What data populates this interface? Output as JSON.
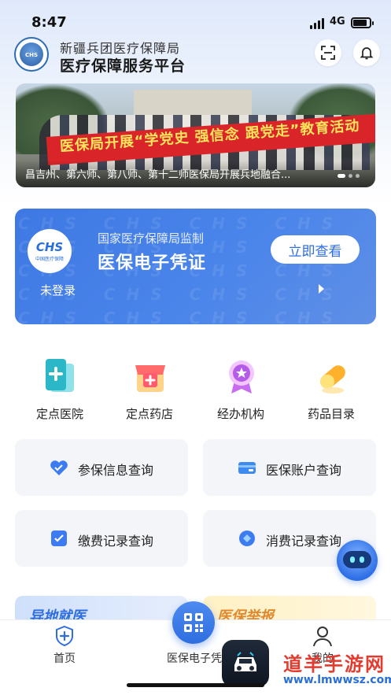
{
  "status_bar": {
    "time": "8:47",
    "network": "4G"
  },
  "header": {
    "org_name": "新疆兵团医疗保障局",
    "platform_name": "医疗保障服务平台",
    "logo_text": "CHS"
  },
  "banner": {
    "flag_text": "医保局开展“学党史 强信念 跟党走”教育活动",
    "caption": "昌吉州、第六师、第八师、第十二师医保局开展兵地融合..."
  },
  "credential_card": {
    "logo_big": "CHS",
    "logo_small": "中国医疗保障",
    "subtitle": "国家医疗保障局监制",
    "title": "医保电子凭证",
    "button": "立即查看",
    "login_status": "未登录",
    "watermark": "CHS CHS CHS CHS CHS CHS CHS CHS CHS CHS CHS CHS CHS CHS CHS CHS CHS CHS CHS CHS CHS CHS CHS CHS CHS CHS CHS CHS CHS CHS"
  },
  "services": [
    {
      "label": "定点医院",
      "icon": "hospital-icon"
    },
    {
      "label": "定点药店",
      "icon": "pharmacy-icon"
    },
    {
      "label": "经办机构",
      "icon": "agency-icon"
    },
    {
      "label": "药品目录",
      "icon": "medicine-icon"
    }
  ],
  "queries": [
    {
      "label": "参保信息查询",
      "icon": "heart-check-icon"
    },
    {
      "label": "医保账户查询",
      "icon": "card-icon"
    },
    {
      "label": "缴费记录查询",
      "icon": "checkbox-icon"
    },
    {
      "label": "消费记录查询",
      "icon": "coin-icon"
    }
  ],
  "promos": [
    {
      "label": "异地就医"
    },
    {
      "label": "医保举报"
    }
  ],
  "tabbar": {
    "home": "首页",
    "center": "医保电子凭",
    "mine": "我的"
  },
  "watermark": {
    "name": "道羊手游网",
    "url": "www.lmwwsz.com"
  },
  "colors": {
    "primary": "#3e78e3",
    "accent_red": "#e23b2f"
  }
}
